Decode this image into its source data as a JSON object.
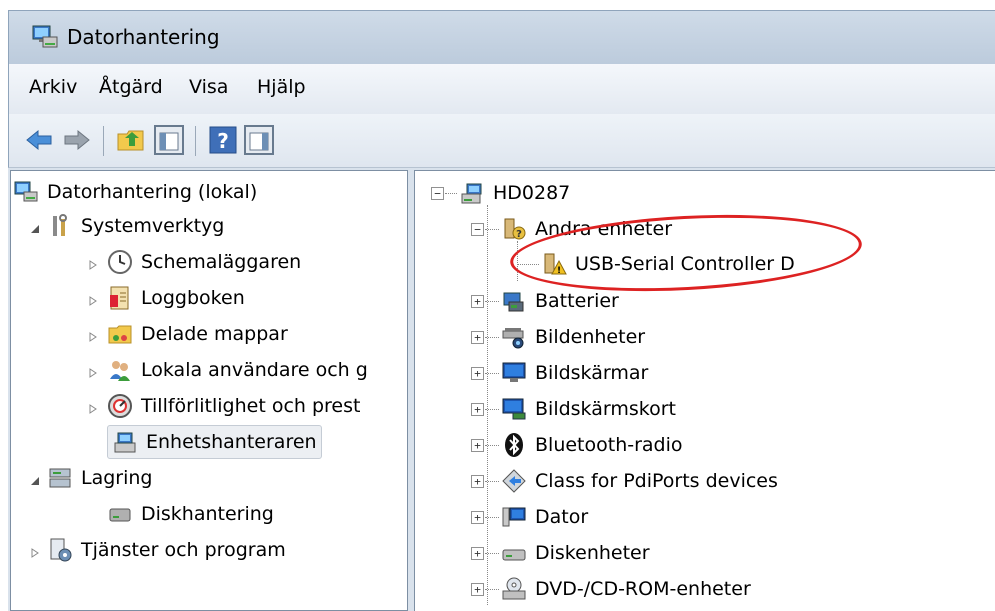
{
  "window": {
    "title": "Datorhantering"
  },
  "menu": {
    "items": [
      "Arkiv",
      "Åtgärd",
      "Visa",
      "Hjälp"
    ]
  },
  "toolbar": {
    "buttons": [
      "back-arrow-icon",
      "forward-arrow-icon",
      "up-folder-icon",
      "show-hide-console-tree-icon",
      "help-icon",
      "show-hide-action-pane-icon"
    ]
  },
  "left_tree": {
    "root": "Datorhantering (lokal)",
    "system_tools": "Systemverktyg",
    "scheduler": "Schemaläggaren",
    "event_viewer": "Loggboken",
    "shared_folders": "Delade mappar",
    "local_users": "Lokala användare och g",
    "reliability": "Tillförlitlighet och prest",
    "device_manager": "Enhetshanteraren",
    "storage": "Lagring",
    "disk_management": "Diskhantering",
    "services": "Tjänster och program"
  },
  "right_tree": {
    "computer": "HD0287",
    "other_devices": "Andra enheter",
    "usb_serial": "USB-Serial Controller D",
    "categories": [
      "Batterier",
      "Bildenheter",
      "Bildskärmar",
      "Bildskärmskort",
      "Bluetooth-radio",
      "Class for PdiPorts devices",
      "Dator",
      "Diskenheter",
      "DVD-/CD-ROM-enheter"
    ]
  },
  "colors": {
    "annotation": "#dd2222",
    "selection": "#eceff3",
    "warning": "#f0c020"
  }
}
